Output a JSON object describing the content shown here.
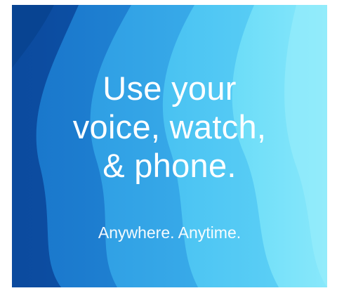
{
  "headline": {
    "line1": "Use your",
    "line2": "voice, watch,",
    "line3": "& phone."
  },
  "tagline": "Anywhere. Anytime.",
  "colors": {
    "deep_blue": "#0a4fa8",
    "mid_blue": "#1f86d6",
    "light_blue": "#3fb4ee",
    "cyan": "#5ad1f7",
    "pale_cyan": "#7ee3fb",
    "text": "#ffffff"
  }
}
